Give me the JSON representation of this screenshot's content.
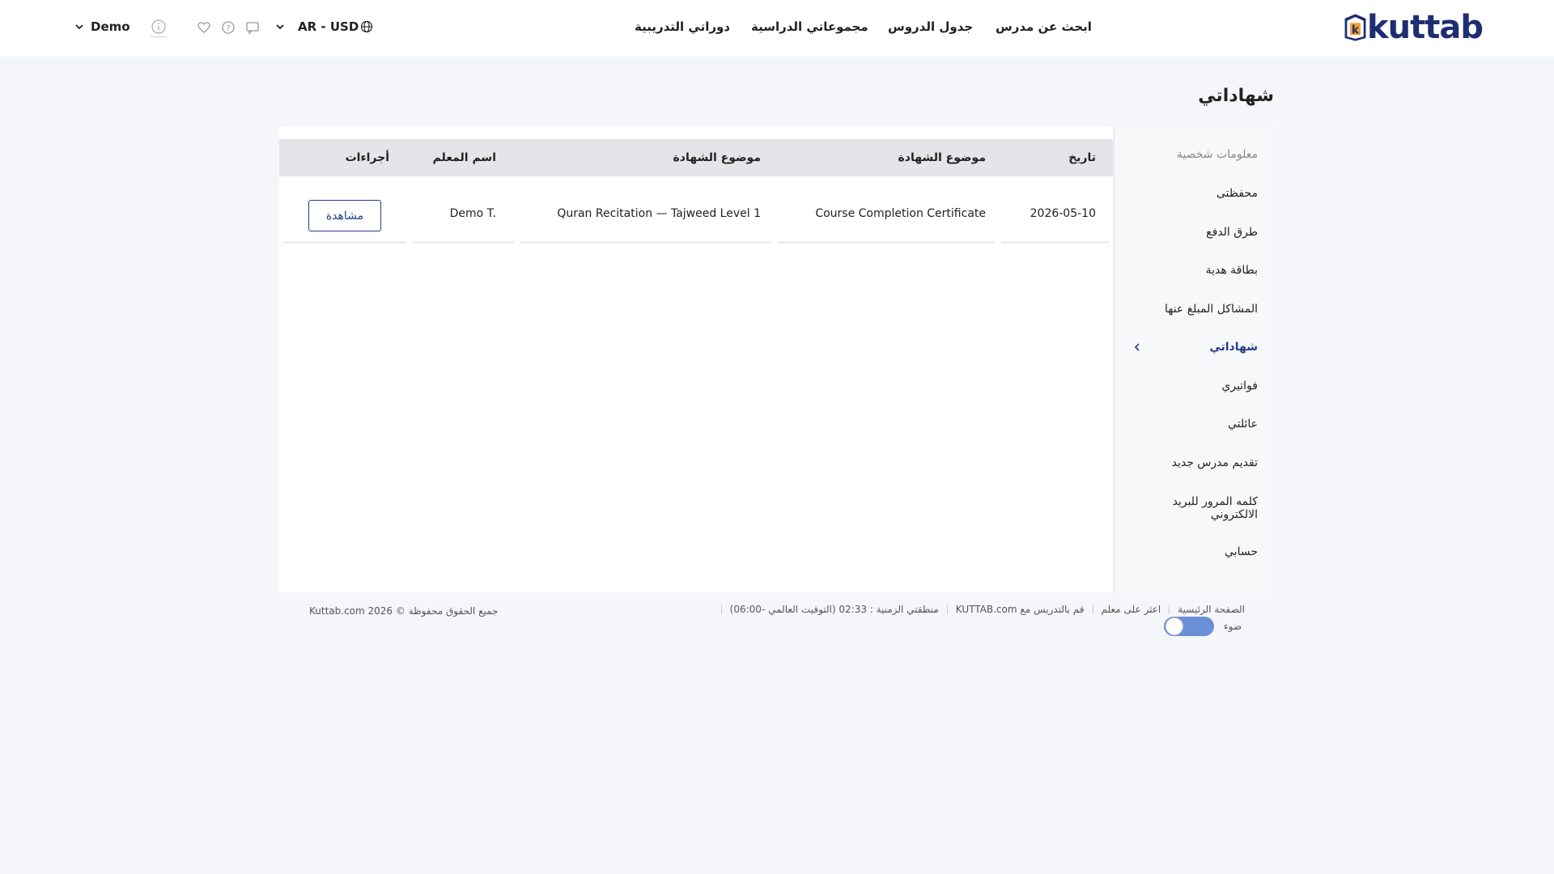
{
  "header": {
    "brand": "kuttab",
    "nav": [
      "ابحث عن مدرس",
      "جدول الدروس",
      "مجموعاتي الدراسية",
      "دوراتي التدريبية"
    ],
    "lang_currency": "AR - USD",
    "user_name": "Demo"
  },
  "page": {
    "title": "شهاداتي"
  },
  "sidebar": {
    "items": [
      {
        "label": "معلومات شخصية"
      },
      {
        "label": "محفظتى"
      },
      {
        "label": "طرق الدفع"
      },
      {
        "label": "بطاقة هدية"
      },
      {
        "label": "المشاكل المبلغ عنها"
      },
      {
        "label": "شهاداتي"
      },
      {
        "label": "فواتيري"
      },
      {
        "label": "عائلتي"
      },
      {
        "label": "تقديم مدرس جديد"
      },
      {
        "label": "كلمه المرور للبريد الالكتروني"
      },
      {
        "label": "حسابي"
      }
    ],
    "active_index": 5
  },
  "table": {
    "headers": [
      "تاريخ",
      "موضوع الشهادة",
      "موضوع الشهادة",
      "اسم المعلم",
      "أجراءات"
    ],
    "rows": [
      {
        "date": "2026-05-10",
        "certificate_type": "Course Completion Certificate",
        "subject": "Quran Recitation — Tajweed Level 1",
        "teacher": "Demo T.",
        "action_label": "مشاهدة"
      }
    ]
  },
  "footer": {
    "links": [
      "الصفحة الرئيسية",
      "اعثر على معلم",
      "قم بالتدريس مع KUTTAB.com",
      "منطقتي الزمنية : 02:33 (التوقيت العالمي -06:00)"
    ],
    "copyright": "جميع الحقوق محفوظة © 2026 Kuttab.com",
    "theme_label": "ضوء"
  },
  "colors": {
    "brand": "#1f2e73",
    "accent": "#1f3f8a",
    "logo_orange": "#f0a132",
    "toggle": "#6b8fd6"
  }
}
